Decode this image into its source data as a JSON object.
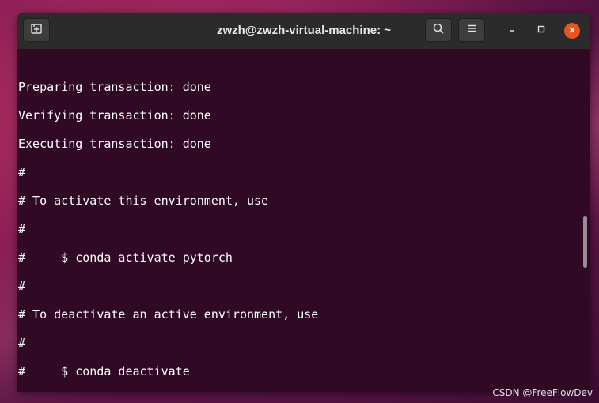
{
  "window": {
    "title": "zwzh@zwzh-virtual-machine: ~"
  },
  "titlebar": {
    "new_tab_icon": "new-tab-icon",
    "search_icon": "search-icon",
    "menu_icon": "hamburger-menu-icon",
    "minimize_icon": "minimize-icon",
    "maximize_icon": "maximize-icon",
    "close_icon": "close-icon"
  },
  "terminal": {
    "lines": [
      "Preparing transaction: done",
      "Verifying transaction: done",
      "Executing transaction: done",
      "#",
      "# To activate this environment, use",
      "#",
      "#     $ conda activate pytorch",
      "#",
      "# To deactivate an active environment, use",
      "#",
      "#     $ conda deactivate"
    ]
  },
  "watermark": {
    "text": "CSDN @FreeFlowDev"
  },
  "colors": {
    "terminal_bg": "#300a24",
    "titlebar_bg": "#2b2b2b",
    "close_button": "#e95420",
    "text": "#ffffff"
  }
}
